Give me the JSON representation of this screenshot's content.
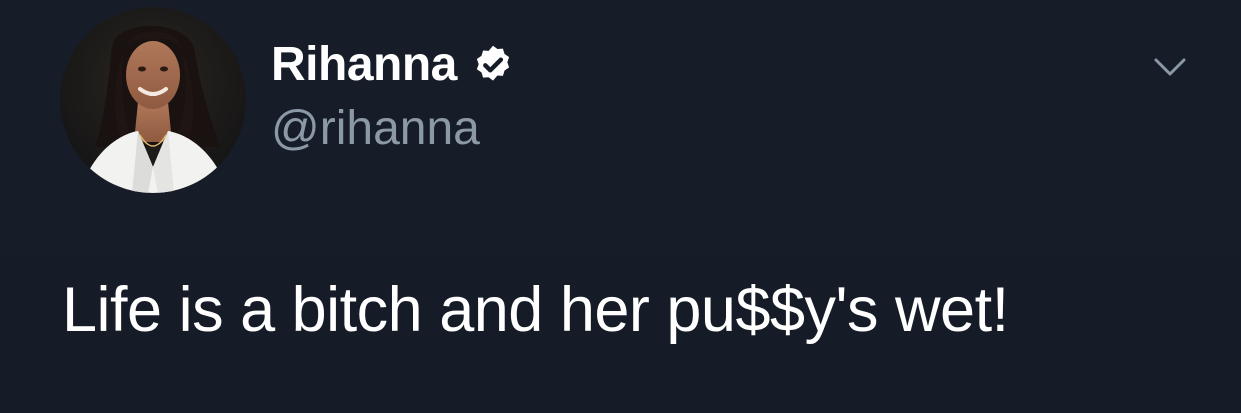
{
  "tweet": {
    "author": {
      "display_name": "Rihanna",
      "handle": "@rihanna",
      "verified": true,
      "avatar": "profile-photo"
    },
    "text": "Life is a bitch and her pu$$y's wet!",
    "menu_icon": "chevron-down-icon"
  },
  "colors": {
    "background": "#161c27",
    "primary_text": "#ffffff",
    "secondary_text": "#8b98a5",
    "verified_badge": "#ffffff"
  }
}
